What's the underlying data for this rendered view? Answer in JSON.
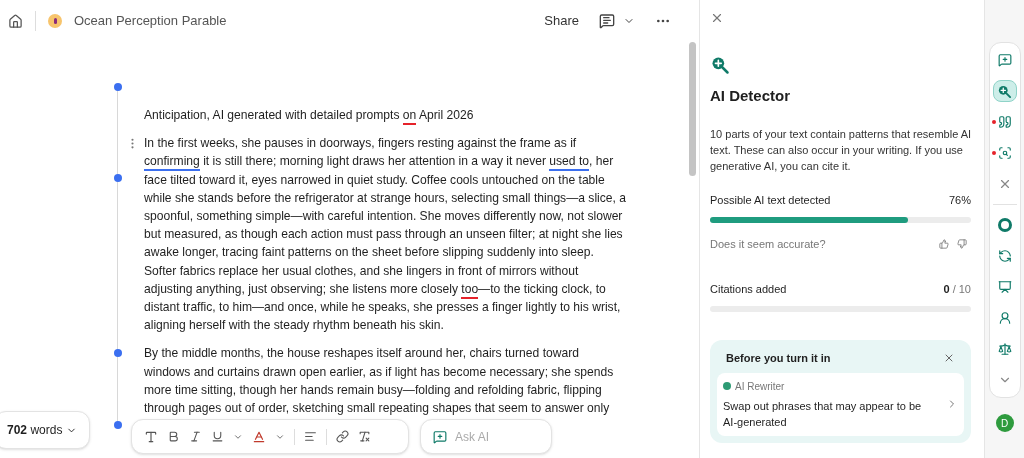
{
  "header": {
    "title": "Ocean Perception Parable",
    "share": "Share"
  },
  "document": {
    "paragraphs": [
      {
        "segments": [
          {
            "text": "Anticipation, AI generated with detailed prompts "
          },
          {
            "text": "on",
            "color": "#e5222a"
          },
          {
            "text": " April 2026"
          }
        ]
      },
      {
        "segments": [
          {
            "text": "In the first weeks, she pauses in doorways, fingers resting against the frame as if "
          },
          {
            "text": "confirming",
            "color": "#3b6ff0"
          },
          {
            "text": " it is still there; morning light draws her attention in a way it never "
          },
          {
            "text": "used to",
            "color": "#3b6ff0"
          },
          {
            "text": ", her face tilted toward it, eyes narrowed in quiet study. Coffee cools untouched on the table while she stands before the refrigerator at strange hours, selecting small things—a slice, a spoonful, something simple—with careful intention. She moves differently now, not slower but measured, as though each action must pass through an unseen filter; at night she lies awake longer, tracing faint patterns on the sheet before slipping suddenly into sleep. Softer fabrics replace her usual clothes, and she lingers in front of mirrors without adjusting anything, just observing; she listens more closely "
          },
          {
            "text": "too",
            "color": "#e5222a"
          },
          {
            "text": "—to the ticking clock, to distant traffic, to him—and once, while he speaks, she presses a finger lightly to his wrist, aligning herself with the steady rhythm beneath his skin."
          }
        ]
      },
      {
        "segments": [
          {
            "text": "By the middle months, the house reshapes itself around her, chairs turned toward windows and curtains drawn open earlier, as if light has become necessary; she spends more time sitting, though her hands remain busy—folding and refolding fabric, flipping through pages out of order, sketching small repeating shapes that seem to answer only"
          }
        ]
      }
    ]
  },
  "word_count": {
    "count": "702",
    "label": "words"
  },
  "toolbar": {
    "ask_ai": {
      "placeholder": "Ask AI"
    }
  },
  "panel": {
    "title": "AI Detector",
    "description": "10 parts of your text contain patterns that resemble AI text. These can also occur in your writing. If you use generative AI, you can cite it.",
    "detection": {
      "label": "Possible AI text detected",
      "value": "76%",
      "level": 0.76
    },
    "feedback": "Does it seem accurate?",
    "citations": {
      "label": "Citations added",
      "count": "0",
      "total": "/ 10",
      "level": 0
    },
    "promo": {
      "title": "Before you turn it in",
      "tag": "AI Rewriter",
      "text": "Swap out phrases that may appear to be AI-generated"
    }
  },
  "rail": {
    "items": [
      {
        "kind": "chat",
        "selected": false,
        "alert": false
      },
      {
        "kind": "detector",
        "selected": true,
        "alert": false
      },
      {
        "kind": "quote",
        "selected": false,
        "alert": true
      },
      {
        "kind": "citation",
        "selected": false,
        "alert": true
      },
      {
        "kind": "close",
        "selected": false,
        "alert": false
      },
      {
        "kind": "divider"
      },
      {
        "kind": "logo",
        "selected": false,
        "alert": false
      },
      {
        "kind": "rewrite",
        "selected": false,
        "alert": false
      },
      {
        "kind": "audience",
        "selected": false,
        "alert": false
      },
      {
        "kind": "expert",
        "selected": false,
        "alert": false
      },
      {
        "kind": "balance",
        "selected": false,
        "alert": false
      },
      {
        "kind": "more",
        "selected": false,
        "alert": false
      }
    ],
    "avatar": "D"
  }
}
